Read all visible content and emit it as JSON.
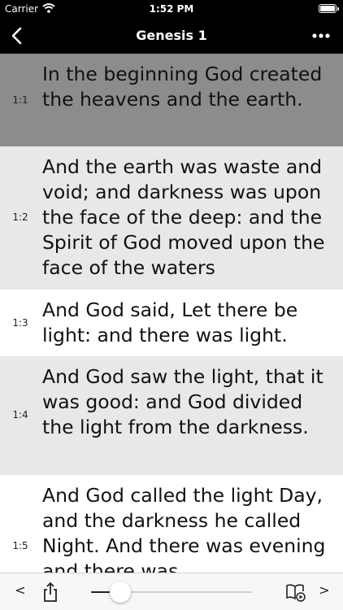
{
  "status_bar": {
    "carrier": "Carrier",
    "time": "1:52 PM"
  },
  "nav": {
    "title": "Genesis 1",
    "back_icon": "chevron-left-icon",
    "more_icon": "ellipsis-icon"
  },
  "verses": [
    {
      "num": "1:1",
      "text": "In the beginning God created the heavens and the earth.",
      "bg": "#8c8c8c"
    },
    {
      "num": "1:2",
      "text": "And the earth was waste and void; and darkness was upon the face of the deep: and the Spirit of God moved upon the face of the waters",
      "bg": "#e8e8e8"
    },
    {
      "num": "1:3",
      "text": "And God said, Let there be light: and there was light.",
      "bg": "#ffffff"
    },
    {
      "num": "1:4",
      "text": "And God saw the light, that it was good: and God divided the light from the darkness.",
      "bg": "#e8e8e8"
    },
    {
      "num": "1:5",
      "text": "And God called the light Day, and the darkness he called Night. And there was evening and there was",
      "bg": "#ffffff"
    }
  ],
  "toolbar": {
    "prev_label": "<",
    "next_label": ">",
    "slider_value": 0.18,
    "icons": [
      "share-icon",
      "book-audio-icon"
    ]
  }
}
